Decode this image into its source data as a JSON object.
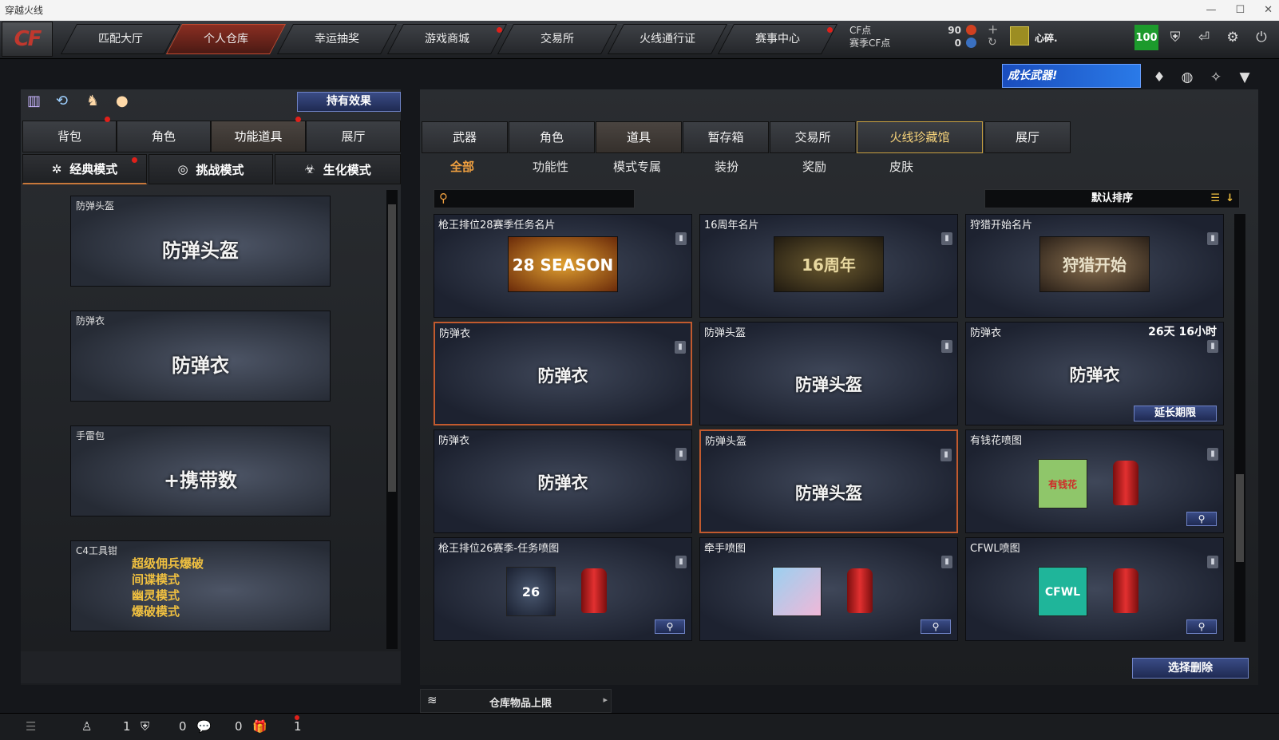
{
  "window": {
    "title": "穿越火线",
    "controls": [
      "—",
      "☐",
      "✕"
    ]
  },
  "nav": {
    "tabs": [
      "匹配大厅",
      "个人仓库",
      "幸运抽奖",
      "游戏商城",
      "交易所",
      "火线通行证",
      "赛事中心"
    ],
    "active": "个人仓库"
  },
  "currency": {
    "cf_label": "CF点",
    "cf_value": "90",
    "event_label": "赛季CF点",
    "event_value": "0"
  },
  "user": {
    "name": "心碎.",
    "level": "100"
  },
  "banner": "成长武器!",
  "left": {
    "effect_button": "持有效果",
    "tabs": [
      "背包",
      "角色",
      "功能道具",
      "展厅"
    ],
    "active_tab": "功能道具",
    "modes": [
      "经典模式",
      "挑战模式",
      "生化模式"
    ],
    "items": [
      {
        "name": "防弹头盔",
        "caption": "防弹头盔"
      },
      {
        "name": "防弹衣",
        "caption": "防弹衣"
      },
      {
        "name": "手雷包",
        "caption": "+携带数"
      },
      {
        "name": "C4工具钳",
        "lines": [
          "超级佣兵爆破",
          "间谍模式",
          "幽灵模式",
          "爆破模式"
        ]
      }
    ]
  },
  "right": {
    "tabs": [
      "武器",
      "角色",
      "道具",
      "暂存箱",
      "交易所",
      "火线珍藏馆",
      "展厅"
    ],
    "active_tab": "道具",
    "highlight_tab": "火线珍藏馆",
    "subtabs": [
      "全部",
      "功能性",
      "模式专属",
      "装扮",
      "奖励",
      "皮肤"
    ],
    "active_sub": "全部",
    "search_placeholder": "",
    "sort": "默认排序",
    "cards": [
      {
        "name": "枪王排位28赛季任务名片",
        "img": "28 SEASON"
      },
      {
        "name": "16周年名片",
        "img": "16周年"
      },
      {
        "name": "狩猎开始名片",
        "img": "狩猎开始"
      },
      {
        "name": "防弹衣",
        "caption": "防弹衣"
      },
      {
        "name": "防弹头盔",
        "caption": "防弹头盔"
      },
      {
        "name": "防弹衣",
        "caption": "防弹衣",
        "timer": "26天 16小时",
        "extend": "延长期限"
      },
      {
        "name": "防弹衣",
        "caption": "防弹衣"
      },
      {
        "name": "防弹头盔",
        "caption": "防弹头盔"
      },
      {
        "name": "有钱花喷图",
        "spray": "有钱花"
      },
      {
        "name": "枪王排位26赛季-任务喷图",
        "spray": "26"
      },
      {
        "name": "牵手喷图",
        "spray": ""
      },
      {
        "name": "CFWL喷图",
        "spray": "CFWL"
      }
    ],
    "delete_button": "选择删除",
    "storage_limit": "仓库物品上限"
  },
  "status": {
    "count1": "1",
    "count2": "0",
    "count3": "0",
    "count4": "1"
  }
}
